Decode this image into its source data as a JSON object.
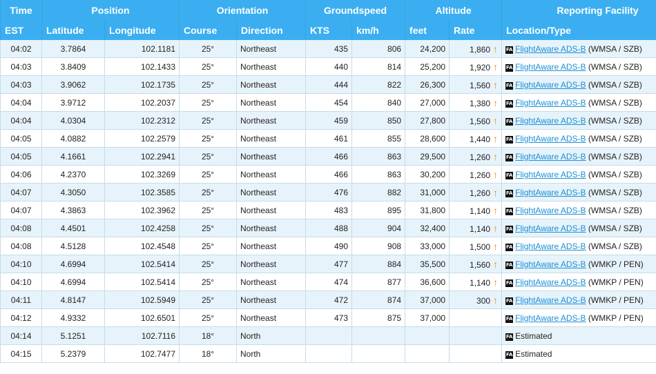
{
  "headers": {
    "group": [
      {
        "label": "Time"
      },
      {
        "label": "Position"
      },
      {
        "label": "Orientation"
      },
      {
        "label": "Groundspeed"
      },
      {
        "label": "Altitude"
      },
      {
        "label": "Reporting Facility"
      }
    ],
    "sub": [
      "EST",
      "Latitude",
      "Longitude",
      "Course",
      "Direction",
      "KTS",
      "km/h",
      "feet",
      "Rate",
      "Location/Type"
    ]
  },
  "icons": {
    "fa_badge_text": "FA",
    "rate_arrow": "up-arrow",
    "arrow_color": "#f28e16"
  },
  "colors": {
    "header_bg": "#3aaef0",
    "row_alt": "#e7f3fa",
    "link": "#1a8fd6"
  },
  "rows": [
    {
      "time": "04:02",
      "lat": "3.7864",
      "lon": "102.1181",
      "course": "25°",
      "dir": "Northeast",
      "kts": "435",
      "kmh": "806",
      "feet": "24,200",
      "rate": "1,860",
      "climb": true,
      "source": "FlightAware ADS-B",
      "facility": "(WMSA / SZB)"
    },
    {
      "time": "04:03",
      "lat": "3.8409",
      "lon": "102.1433",
      "course": "25°",
      "dir": "Northeast",
      "kts": "440",
      "kmh": "814",
      "feet": "25,200",
      "rate": "1,920",
      "climb": true,
      "source": "FlightAware ADS-B",
      "facility": "(WMSA / SZB)"
    },
    {
      "time": "04:03",
      "lat": "3.9062",
      "lon": "102.1735",
      "course": "25°",
      "dir": "Northeast",
      "kts": "444",
      "kmh": "822",
      "feet": "26,300",
      "rate": "1,560",
      "climb": true,
      "source": "FlightAware ADS-B",
      "facility": "(WMSA / SZB)"
    },
    {
      "time": "04:04",
      "lat": "3.9712",
      "lon": "102.2037",
      "course": "25°",
      "dir": "Northeast",
      "kts": "454",
      "kmh": "840",
      "feet": "27,000",
      "rate": "1,380",
      "climb": true,
      "source": "FlightAware ADS-B",
      "facility": "(WMSA / SZB)"
    },
    {
      "time": "04:04",
      "lat": "4.0304",
      "lon": "102.2312",
      "course": "25°",
      "dir": "Northeast",
      "kts": "459",
      "kmh": "850",
      "feet": "27,800",
      "rate": "1,560",
      "climb": true,
      "source": "FlightAware ADS-B",
      "facility": "(WMSA / SZB)"
    },
    {
      "time": "04:05",
      "lat": "4.0882",
      "lon": "102.2579",
      "course": "25°",
      "dir": "Northeast",
      "kts": "461",
      "kmh": "855",
      "feet": "28,600",
      "rate": "1,440",
      "climb": true,
      "source": "FlightAware ADS-B",
      "facility": "(WMSA / SZB)"
    },
    {
      "time": "04:05",
      "lat": "4.1661",
      "lon": "102.2941",
      "course": "25°",
      "dir": "Northeast",
      "kts": "466",
      "kmh": "863",
      "feet": "29,500",
      "rate": "1,260",
      "climb": true,
      "source": "FlightAware ADS-B",
      "facility": "(WMSA / SZB)"
    },
    {
      "time": "04:06",
      "lat": "4.2370",
      "lon": "102.3269",
      "course": "25°",
      "dir": "Northeast",
      "kts": "466",
      "kmh": "863",
      "feet": "30,200",
      "rate": "1,260",
      "climb": true,
      "source": "FlightAware ADS-B",
      "facility": "(WMSA / SZB)"
    },
    {
      "time": "04:07",
      "lat": "4.3050",
      "lon": "102.3585",
      "course": "25°",
      "dir": "Northeast",
      "kts": "476",
      "kmh": "882",
      "feet": "31,000",
      "rate": "1,260",
      "climb": true,
      "source": "FlightAware ADS-B",
      "facility": "(WMSA / SZB)"
    },
    {
      "time": "04:07",
      "lat": "4.3863",
      "lon": "102.3962",
      "course": "25°",
      "dir": "Northeast",
      "kts": "483",
      "kmh": "895",
      "feet": "31,800",
      "rate": "1,140",
      "climb": true,
      "source": "FlightAware ADS-B",
      "facility": "(WMSA / SZB)"
    },
    {
      "time": "04:08",
      "lat": "4.4501",
      "lon": "102.4258",
      "course": "25°",
      "dir": "Northeast",
      "kts": "488",
      "kmh": "904",
      "feet": "32,400",
      "rate": "1,140",
      "climb": true,
      "source": "FlightAware ADS-B",
      "facility": "(WMSA / SZB)"
    },
    {
      "time": "04:08",
      "lat": "4.5128",
      "lon": "102.4548",
      "course": "25°",
      "dir": "Northeast",
      "kts": "490",
      "kmh": "908",
      "feet": "33,000",
      "rate": "1,500",
      "climb": true,
      "source": "FlightAware ADS-B",
      "facility": "(WMSA / SZB)"
    },
    {
      "time": "04:10",
      "lat": "4.6994",
      "lon": "102.5414",
      "course": "25°",
      "dir": "Northeast",
      "kts": "477",
      "kmh": "884",
      "feet": "35,500",
      "rate": "1,560",
      "climb": true,
      "source": "FlightAware ADS-B",
      "facility": "(WMKP / PEN)"
    },
    {
      "time": "04:10",
      "lat": "4.6994",
      "lon": "102.5414",
      "course": "25°",
      "dir": "Northeast",
      "kts": "474",
      "kmh": "877",
      "feet": "36,600",
      "rate": "1,140",
      "climb": true,
      "source": "FlightAware ADS-B",
      "facility": "(WMKP / PEN)"
    },
    {
      "time": "04:11",
      "lat": "4.8147",
      "lon": "102.5949",
      "course": "25°",
      "dir": "Northeast",
      "kts": "472",
      "kmh": "874",
      "feet": "37,000",
      "rate": "300",
      "climb": true,
      "source": "FlightAware ADS-B",
      "facility": "(WMKP / PEN)"
    },
    {
      "time": "04:12",
      "lat": "4.9332",
      "lon": "102.6501",
      "course": "25°",
      "dir": "Northeast",
      "kts": "473",
      "kmh": "875",
      "feet": "37,000",
      "rate": "",
      "climb": false,
      "source": "FlightAware ADS-B",
      "facility": "(WMKP / PEN)"
    },
    {
      "time": "04:14",
      "lat": "5.1251",
      "lon": "102.7116",
      "course": "18°",
      "dir": "North",
      "kts": "",
      "kmh": "",
      "feet": "",
      "rate": "",
      "climb": false,
      "source": "",
      "facility": "Estimated"
    },
    {
      "time": "04:15",
      "lat": "5.2379",
      "lon": "102.7477",
      "course": "18°",
      "dir": "North",
      "kts": "",
      "kmh": "",
      "feet": "",
      "rate": "",
      "climb": false,
      "source": "",
      "facility": "Estimated"
    }
  ]
}
